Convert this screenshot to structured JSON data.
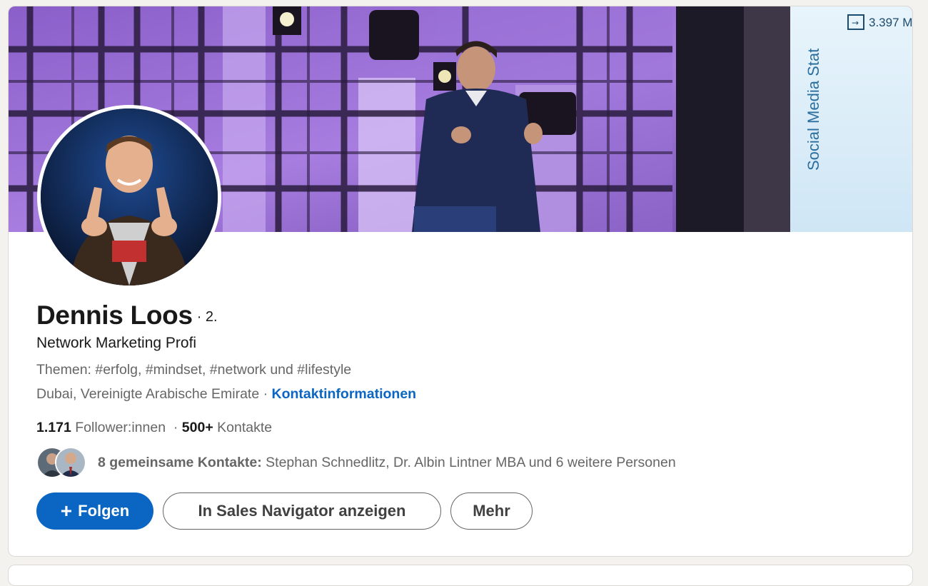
{
  "profile": {
    "name": "Dennis Loos",
    "degree": "· 2.",
    "headline": "Network Marketing Profi",
    "topics": "Themen: #erfolg, #mindset, #network und #lifestyle",
    "location": "Dubai, Vereinigte Arabische Emirate",
    "location_sep": " · ",
    "contact_info_label": "Kontaktinformationen"
  },
  "banner": {
    "screen_text": "Social Media Stat",
    "screen_counter": "3.397 M"
  },
  "stats": {
    "followers_count": "1.171",
    "followers_label": " Follower:innen",
    "sep": "  · ",
    "connections_count": "500+",
    "connections_label": " Kontakte"
  },
  "mutual": {
    "count_label": "8 gemeinsame Kontakte:",
    "names": " Stephan Schnedlitz, Dr. Albin Lintner MBA und 6 weitere Personen"
  },
  "actions": {
    "follow_icon": "+",
    "follow_label": "Folgen",
    "sales_navigator_label": "In Sales Navigator anzeigen",
    "more_label": "Mehr"
  },
  "colors": {
    "brand_blue": "#0a66c2",
    "page_bg": "#f4f2ee",
    "muted_text": "#666666"
  }
}
